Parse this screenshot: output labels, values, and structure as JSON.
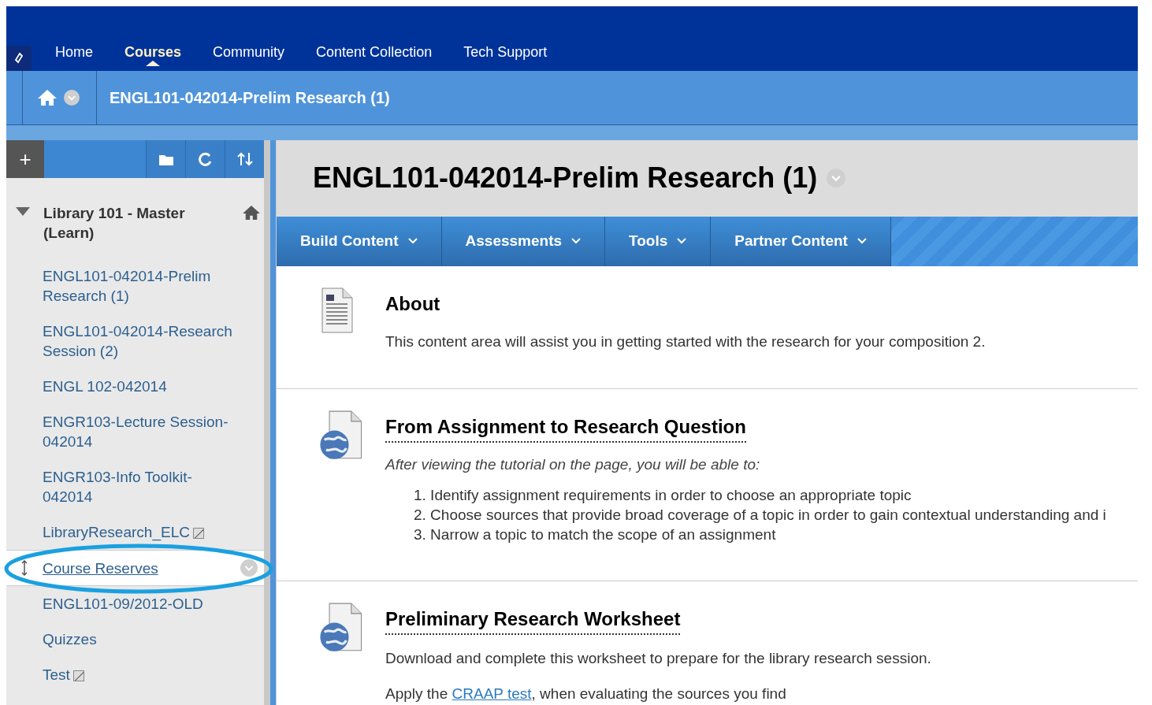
{
  "top_nav": [
    {
      "label": "Home",
      "selected": false
    },
    {
      "label": "Courses",
      "selected": true
    },
    {
      "label": "Community",
      "selected": false
    },
    {
      "label": "Content Collection",
      "selected": false
    },
    {
      "label": "Tech Support",
      "selected": false
    }
  ],
  "breadcrumb": "ENGL101-042014-Prelim Research (1)",
  "sidebar": {
    "toolbar": [
      "+"
    ],
    "course": {
      "title": "Library 101 - Master (Learn)",
      "expanded": true
    },
    "items": [
      {
        "label": "ENGL101-042014-Prelim Research (1)",
        "selected": false,
        "hidden_mark": false
      },
      {
        "label": "ENGL101-042014-Research Session (2)",
        "selected": false,
        "hidden_mark": false
      },
      {
        "label": "ENGL 102-042014",
        "selected": false,
        "hidden_mark": false
      },
      {
        "label": "ENGR103-Lecture Session-042014",
        "selected": false,
        "hidden_mark": false
      },
      {
        "label": "ENGR103-Info Toolkit-042014",
        "selected": false,
        "hidden_mark": false
      },
      {
        "label": "LibraryResearch_ELC",
        "selected": false,
        "hidden_mark": true
      },
      {
        "label": "Course Reserves",
        "selected": true,
        "hidden_mark": false
      },
      {
        "label": "ENGL101-09/2012-OLD",
        "selected": false,
        "hidden_mark": false
      },
      {
        "label": "Quizzes",
        "selected": false,
        "hidden_mark": false
      },
      {
        "label": "Test",
        "selected": false,
        "hidden_mark": true
      }
    ]
  },
  "page_title": "ENGL101-042014-Prelim Research (1)",
  "action_bar": [
    "Build Content",
    "Assessments",
    "Tools",
    "Partner Content"
  ],
  "content_items": [
    {
      "kind": "document",
      "title": "About",
      "linked": false,
      "paragraphs": [
        {
          "text": "This content area will assist you in getting started with the research for your composition 2."
        }
      ]
    },
    {
      "kind": "web",
      "title": "From Assignment to Research Question",
      "linked": true,
      "intro": "After viewing the tutorial on the page, you will be able to:",
      "list": [
        "1. Identify assignment requirements in order to choose an appropriate topic",
        "2. Choose sources that provide broad coverage of a topic in order to gain contextual understanding and i",
        "3. Narrow a topic to match the scope of an assignment"
      ]
    },
    {
      "kind": "web",
      "title": "Preliminary Research Worksheet",
      "linked": true,
      "paragraphs": [
        {
          "text": "Download and complete this worksheet to prepare for the library research session."
        },
        {
          "before": "Apply the",
          "link": "CRAAP test",
          "after": ", when evaluating the sources you find"
        }
      ]
    }
  ]
}
